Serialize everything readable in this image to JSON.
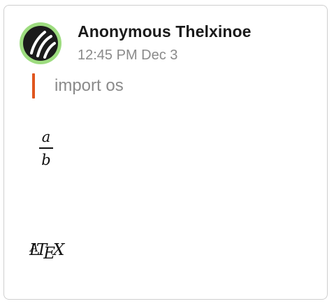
{
  "message": {
    "author": "Anonymous Thelxinoe",
    "timestamp": "12:45 PM Dec 3",
    "quote": "import os",
    "math_fraction": {
      "numerator": "a",
      "denominator": "b"
    },
    "latex_logo": {
      "L": "L",
      "A": "A",
      "T": "T",
      "E": "E",
      "X": "X"
    }
  },
  "colors": {
    "avatar_ring": "#9ddc7f",
    "avatar_fill": "#1b1b1b",
    "quote_bar": "#e0561e"
  },
  "icons": {
    "avatar": "avatar-stripes-icon"
  }
}
